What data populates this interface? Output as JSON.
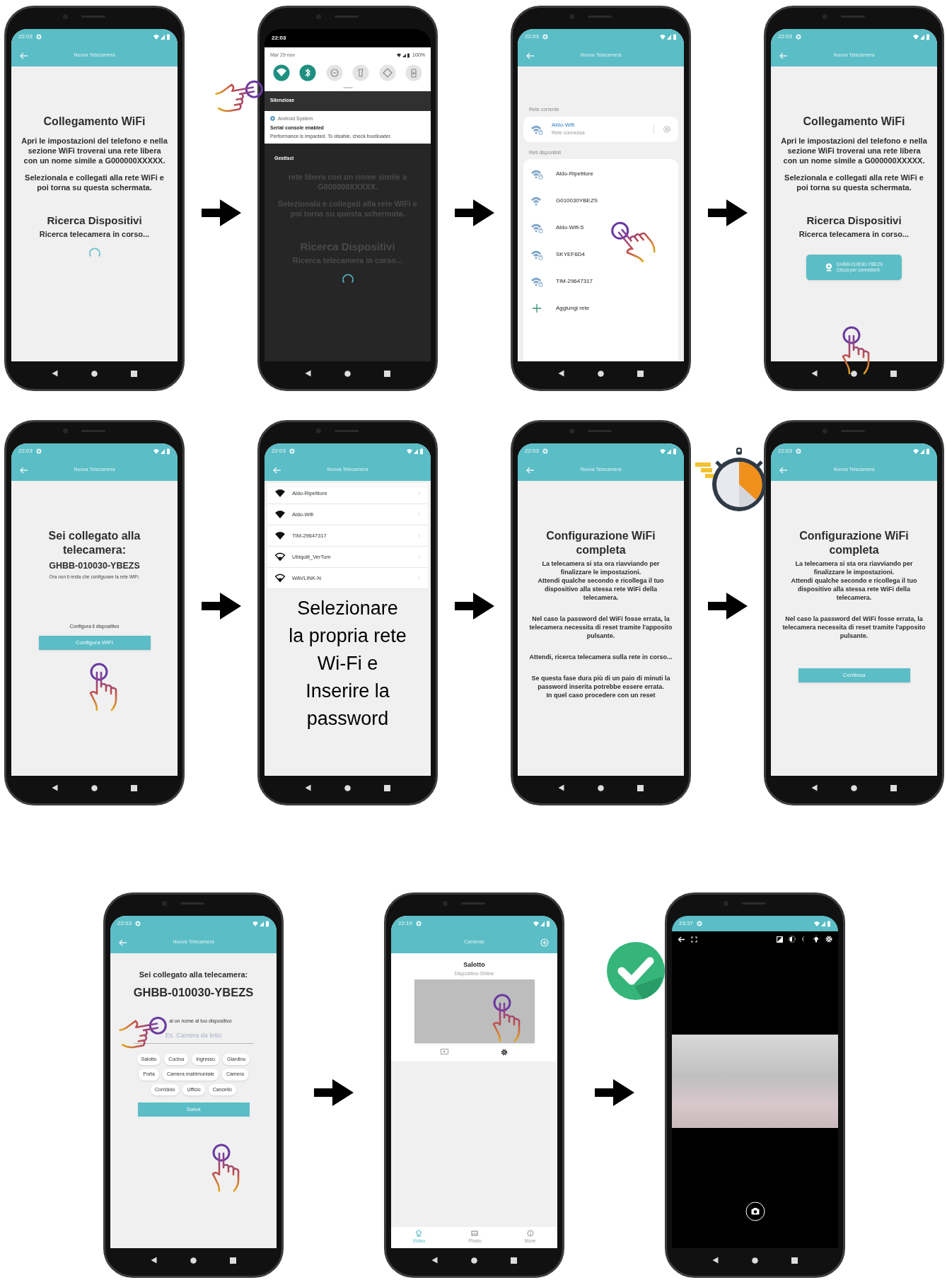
{
  "steps": [
    {
      "kind": "info",
      "status_time": "22:03",
      "app_bar": {
        "title": "Nuova Telecamera",
        "back": true
      },
      "blocks": [
        {
          "kind": "heading",
          "text": "Collegamento WiFi"
        },
        {
          "kind": "paragraph",
          "text": "Apri le impostazioni del telefono e nella sezione WiFi troverai una rete libera con un nome simile a G000000XXXXX."
        },
        {
          "kind": "paragraph",
          "text": "Selezionala e collegati alla rete WiFi e poi torna su questa schermata."
        },
        {
          "kind": "section_heading",
          "text": "Ricerca Dispositivi"
        },
        {
          "kind": "subheading",
          "text": "Ricerca telecamera in corso..."
        },
        {
          "kind": "spinner"
        }
      ]
    },
    {
      "kind": "quick_settings",
      "status_time": "22:03",
      "date": "Mar 29 nov",
      "battery": "100%",
      "toggles": [
        {
          "kind": "wifi",
          "on": true
        },
        {
          "kind": "bluetooth",
          "on": true
        },
        {
          "kind": "dnd",
          "on": false
        },
        {
          "kind": "flashlight",
          "on": false
        },
        {
          "kind": "rotate",
          "on": false
        },
        {
          "kind": "battery_saver",
          "on": false
        }
      ],
      "section": "Silenziose",
      "notification": {
        "app": "Android System",
        "title": "Serial console enabled",
        "body": "Performance is impacted. To disable, check bootloader."
      },
      "manage": "Gestisci",
      "dimmed_blocks": [
        {
          "kind": "paragraph",
          "text": "rete libera con un nome simile a G000000XXXXX."
        },
        {
          "kind": "paragraph",
          "text": "Selezionala e collegati alla rete WiFi e poi torna su questa schermata."
        },
        {
          "kind": "section_heading",
          "text": "Ricerca Dispositivi"
        },
        {
          "kind": "subheading",
          "text": "Ricerca telecamera in corso..."
        },
        {
          "kind": "spinner"
        }
      ]
    },
    {
      "kind": "wifi_settings",
      "status_time": "22:03",
      "app_bar": {
        "title": "Nuova Telecamera",
        "back": true
      },
      "current_label": "Rete corrente",
      "current": {
        "name": "Aldo-Wifi",
        "status": "Rete connessa"
      },
      "available_label": "Reti disponibili",
      "networks": [
        {
          "kind": "network",
          "name": "Aldo-Ripetitore",
          "secured": true
        },
        {
          "kind": "network",
          "name": "G010030YBEZS",
          "secured": false
        },
        {
          "kind": "network",
          "name": "Aldo-Wifi-5",
          "secured": true
        },
        {
          "kind": "network",
          "name": "SKYEF6D4",
          "secured": true
        },
        {
          "kind": "network",
          "name": "TIM-29647317",
          "secured": true
        },
        {
          "kind": "add",
          "name": "Aggiungi rete"
        }
      ]
    },
    {
      "kind": "info",
      "status_time": "22:03",
      "app_bar": {
        "title": "Nuova Telecamera",
        "back": true
      },
      "blocks": [
        {
          "kind": "heading",
          "text": "Collegamento WiFi"
        },
        {
          "kind": "paragraph",
          "text": "Apri le impostazioni del telefono e nella sezione WiFi troverai una rete libera con un nome simile a G000000XXXXX."
        },
        {
          "kind": "paragraph",
          "text": "Selezionala e collegati alla rete WiFi e poi torna su questa schermata."
        },
        {
          "kind": "section_heading",
          "text": "Ricerca Dispositivi"
        },
        {
          "kind": "subheading",
          "text": "Ricerca telecamera in corso..."
        },
        {
          "kind": "device_button",
          "title": "GHBB-010030-YBEZS",
          "subtitle": "Clicca per connetterti"
        }
      ]
    },
    {
      "kind": "info",
      "status_time": "22:03",
      "app_bar": {
        "title": "Nuova Telecamera",
        "back": true
      },
      "blocks": [
        {
          "kind": "heading",
          "text": "Sei collegato alla telecamera:"
        },
        {
          "kind": "code",
          "text": "GHBB-010030-YBEZS"
        },
        {
          "kind": "caption",
          "text": "Ora non ti resta che configurare la rete WiFi."
        },
        {
          "kind": "label",
          "text": "Configura il dispositivo"
        },
        {
          "kind": "button",
          "text": "Configura WiFi"
        }
      ]
    },
    {
      "kind": "network_list",
      "status_time": "22:03",
      "app_bar": {
        "title": "Nuova Telecamera",
        "back": true
      },
      "networks": [
        {
          "name": "Aldo-Ripetitore",
          "strong": true
        },
        {
          "name": "Aldo-Wifi",
          "strong": true
        },
        {
          "name": "TIM-29647317",
          "strong": true
        },
        {
          "name": "Ubiquiti_VerTom",
          "strong": false
        },
        {
          "name": "WAVLINK-N",
          "strong": false
        }
      ],
      "caption": "Selezionare\nla propria rete\nWi-Fi e\nInserire la\npassword"
    },
    {
      "kind": "info",
      "status_time": "22:03",
      "app_bar": {
        "title": "Nuova Telecamera",
        "back": true
      },
      "blocks": [
        {
          "kind": "heading",
          "text": "Configurazione WiFi completa"
        },
        {
          "kind": "note",
          "text": "La telecamera si sta ora riavviando per finalizzare le impostazioni.\nAttendi qualche secondo e ricollega il tuo dispositivo alla stessa rete WiFi della telecamera."
        },
        {
          "kind": "note",
          "text": "Nel caso la password del WiFi fosse errata, la telecamera necessita di reset tramite l'apposito pulsante."
        },
        {
          "kind": "note",
          "text": "Attendi, ricerca telecamera sulla rete in corso..."
        },
        {
          "kind": "note",
          "text": "Se questa fase dura più di un paio di minuti la password inserita potrebbe essere errata.\nIn quel caso procedere con un reset"
        }
      ]
    },
    {
      "kind": "info",
      "status_time": "22:03",
      "app_bar": {
        "title": "Nuova Telecamera",
        "back": true
      },
      "blocks": [
        {
          "kind": "heading",
          "text": "Configurazione WiFi completa"
        },
        {
          "kind": "note",
          "text": "La telecamera si sta ora riavviando per finalizzare le impostazioni.\nAttendi qualche secondo e ricollega il tuo dispositivo alla stessa rete WiFi della telecamera."
        },
        {
          "kind": "note",
          "text": "Nel caso la password del WiFi fosse errata, la telecamera necessita di reset tramite l'apposito pulsante."
        },
        {
          "kind": "button",
          "text": "Continua"
        }
      ]
    },
    {
      "kind": "name_form",
      "status_time": "22:03",
      "app_bar": {
        "title": "Nuova Telecamera",
        "back": true
      },
      "heading": "Sei collegato alla telecamera:",
      "code": "GHBB-010030-YBEZS",
      "label": "ai un nome al tuo dispositivo",
      "placeholder": "Es. Camera da letto",
      "chips": [
        "Salotto",
        "Cucina",
        "Ingresso",
        "Giardino",
        "Porta",
        "Camera matrimoniale",
        "Camera",
        "Corridoio",
        "Ufficio",
        "Cancello"
      ],
      "button": "Salva"
    },
    {
      "kind": "cameras",
      "status_time": "22:19",
      "app_bar": {
        "title": "Cameras",
        "back": false,
        "add": true
      },
      "camera": {
        "name": "Salotto",
        "status": "Dispositivo Online"
      },
      "tabs": [
        {
          "kind": "video",
          "label": "Video",
          "selected": true
        },
        {
          "kind": "photo",
          "label": "Photo",
          "selected": false
        },
        {
          "kind": "more",
          "label": "More",
          "selected": false
        }
      ]
    },
    {
      "kind": "live_view",
      "status_time": "23:37"
    }
  ]
}
